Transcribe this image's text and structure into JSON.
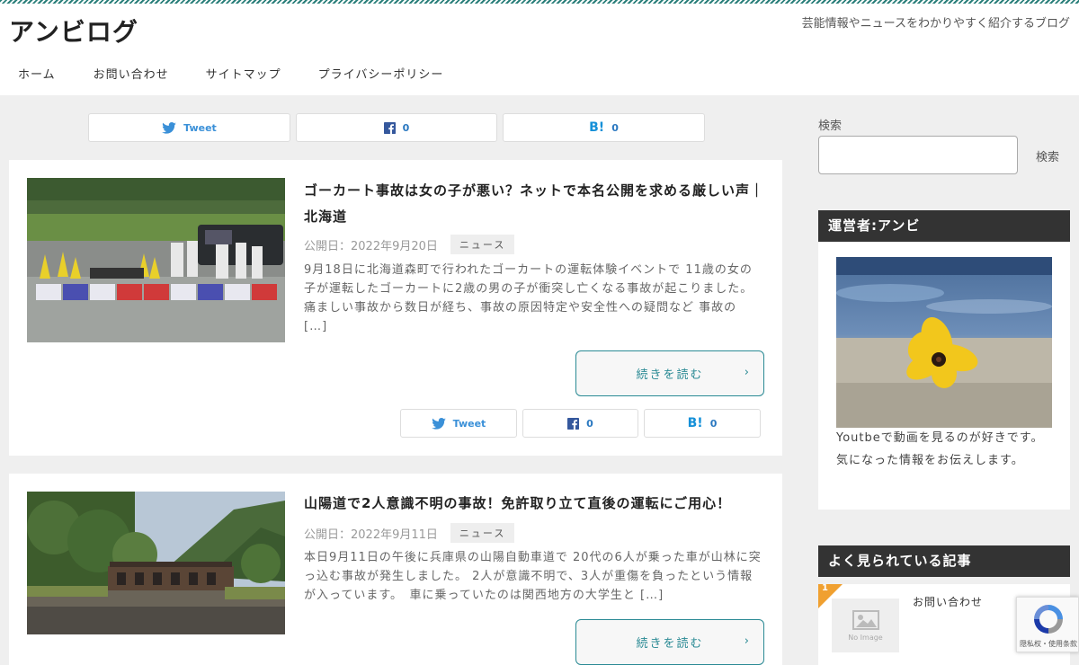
{
  "site": {
    "title": "アンビログ",
    "tagline": "芸能情報やニュースをわかりやすく紹介するブログ"
  },
  "nav": [
    "ホーム",
    "お問い合わせ",
    "サイトマップ",
    "プライバシーポリシー"
  ],
  "share": {
    "tweet": "Tweet",
    "facebook_count": "0",
    "hatena_mark": "B!",
    "hatena_count": "0"
  },
  "posts": [
    {
      "title": "ゴーカート事故は女の子が悪い？ネットで本名公開を求める厳しい声｜北海道",
      "date": "公開日：2022年9月20日",
      "category": "ニュース",
      "excerpt": "9月18日に北海道森町で行われたゴーカートの運転体験イベントで 11歳の女の子が運転したゴーカートに2歳の男の子が衝突し亡くなる事故が起こりました。痛ましい事故から数日が経ち、事故の原因特定や安全性への疑問など 事故の […]",
      "more": "続きを読む"
    },
    {
      "title": "山陽道で2人意識不明の事故！免許取り立て直後の運転にご用心！",
      "date": "公開日：2022年9月11日",
      "category": "ニュース",
      "excerpt": "本日9月11日の午後に兵庫県の山陽自動車道で 20代の6人が乗った車が山林に突っ込む事故が発生しました。 2人が意識不明で、3人が重傷を負ったという情報が入っています。　車に乗っていたのは関西地方の大学生と […]",
      "more": "続きを読む"
    }
  ],
  "sidebar": {
    "search_label": "検索",
    "search_button": "検索",
    "profile_heading": "運営者:アンビ",
    "profile_text_1": "Youtbeで動画を見るのが好きです。",
    "profile_text_2": "気になった情報をお伝えします。",
    "popular_heading": "よく見られている記事",
    "popular_rank": "1",
    "popular_noimage": "No Image",
    "popular_title": "お問い合わせ"
  },
  "recaptcha": {
    "text": "隠私权・使用条款"
  },
  "colors": {
    "accent": "#2a8a94",
    "widget_head": "#333333",
    "rank_ribbon": "#f0a030"
  }
}
